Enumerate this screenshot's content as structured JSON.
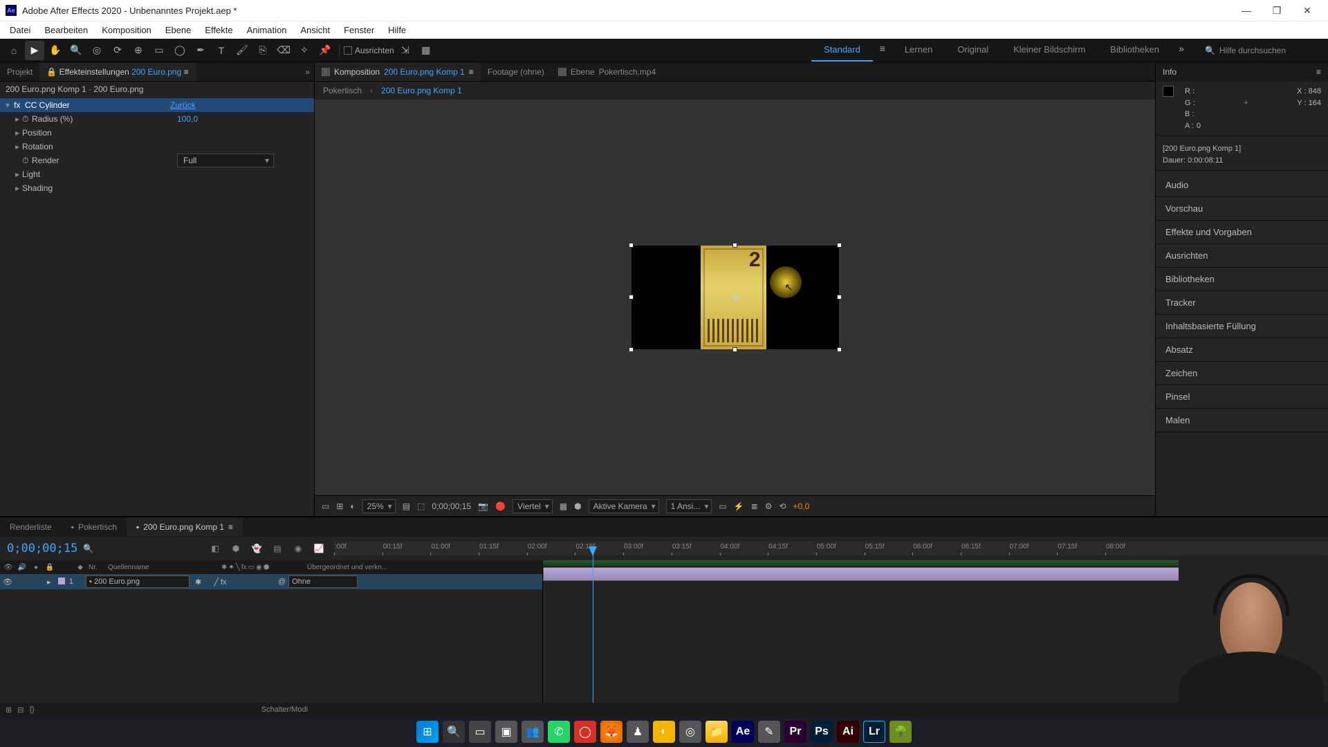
{
  "window": {
    "title": "Adobe After Effects 2020 - Unbenanntes Projekt.aep *",
    "logo": "Ae"
  },
  "menu": [
    "Datei",
    "Bearbeiten",
    "Komposition",
    "Ebene",
    "Effekte",
    "Animation",
    "Ansicht",
    "Fenster",
    "Hilfe"
  ],
  "align_label": "Ausrichten",
  "workspaces": [
    "Standard",
    "Lernen",
    "Original",
    "Kleiner Bildschirm",
    "Bibliotheken"
  ],
  "workspace_active": "Standard",
  "search_placeholder": "Hilfe durchsuchen",
  "left": {
    "tab_project": "Projekt",
    "tab_effects": "Effekteinstellungen",
    "tab_effects_target": "200 Euro.png",
    "breadcrumb": "200 Euro.png Komp 1 · 200 Euro.png",
    "effect_name": "CC Cylinder",
    "reset": "Zurück",
    "radius_label": "Radius (%)",
    "radius_value": "100,0",
    "position_label": "Position",
    "rotation_label": "Rotation",
    "render_label": "Render",
    "render_value": "Full",
    "light_label": "Light",
    "shading_label": "Shading"
  },
  "center": {
    "tab_comp_prefix": "Komposition",
    "tab_comp_name": "200 Euro.png Komp 1",
    "tab_footage": "Footage (ohne)",
    "tab_layer_prefix": "Ebene",
    "tab_layer_name": "Pokertisch.mp4",
    "path_root": "Pokertisch",
    "path_current": "200 Euro.png Komp 1",
    "banknote_digit": "2",
    "footer": {
      "zoom": "25%",
      "time": "0;00;00;15",
      "res": "Viertel",
      "camera": "Aktive Kamera",
      "views": "1 Ansi...",
      "exposure": "+0,0"
    }
  },
  "info": {
    "title": "Info",
    "r": "R :",
    "g": "G :",
    "b": "B :",
    "a": "A :",
    "a_val": "0",
    "x": "X :",
    "x_val": "848",
    "y": "Y :",
    "y_val": "164",
    "comp_name": "[200 Euro.png Komp 1]",
    "duration": "Dauer: 0:00:08:11"
  },
  "right_sections": [
    "Audio",
    "Vorschau",
    "Effekte und Vorgaben",
    "Ausrichten",
    "Bibliotheken",
    "Tracker",
    "Inhaltsbasierte Füllung",
    "Absatz",
    "Zeichen",
    "Pinsel",
    "Malen"
  ],
  "timeline": {
    "tabs": {
      "render": "Renderliste",
      "poker": "Pokertisch",
      "active": "200 Euro.png Komp 1"
    },
    "time_display": "0;00;00;15",
    "col_nr": "Nr.",
    "col_name": "Quellenname",
    "col_parent": "Übergeordnet und verkn...",
    "layer_nr": "1",
    "layer_name": "200 Euro.png",
    "layer_parent": "Ohne",
    "ruler": [
      ":00f",
      "00:15f",
      "01:00f",
      "01:15f",
      "02:00f",
      "02:15f",
      "03:00f",
      "03:15f",
      "04:00f",
      "04:15f",
      "05:00f",
      "05:15f",
      "06:00f",
      "06:15f",
      "07:00f",
      "07:15f",
      "08:00f"
    ],
    "switch_label": "Schalter/Modi"
  },
  "taskbar": {
    "ae": "Ae",
    "pr": "Pr",
    "ps": "Ps",
    "ai": "Ai",
    "lr": "Lr"
  }
}
